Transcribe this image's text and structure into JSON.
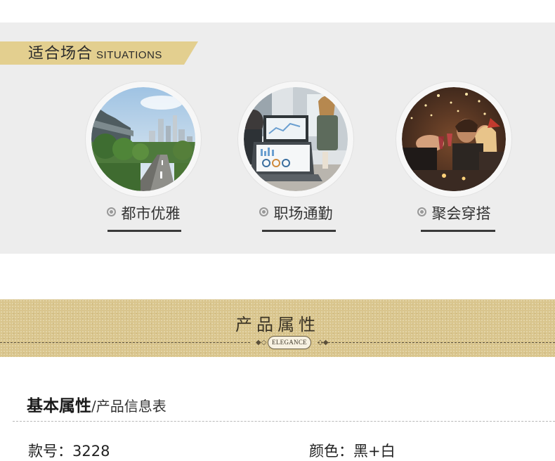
{
  "situations": {
    "title_cn": "适合场合",
    "title_en": "SITUATIONS",
    "accent_color": "#e3cf8f",
    "items": [
      {
        "label": "都市优雅",
        "icon": "city-skyline-photo"
      },
      {
        "label": "职场通勤",
        "icon": "office-laptop-photo"
      },
      {
        "label": "聚会穿搭",
        "icon": "party-toast-photo"
      }
    ]
  },
  "attributes_banner": {
    "title": "产品属性",
    "badge": "ELEGANCE",
    "background_color": "#d9c58d"
  },
  "basic": {
    "title_main": "基本属性",
    "title_sub": "/产品信息表",
    "fields": [
      {
        "label": "款号：",
        "value": "3228"
      },
      {
        "label": "颜色：",
        "value": "黑+白"
      }
    ]
  }
}
